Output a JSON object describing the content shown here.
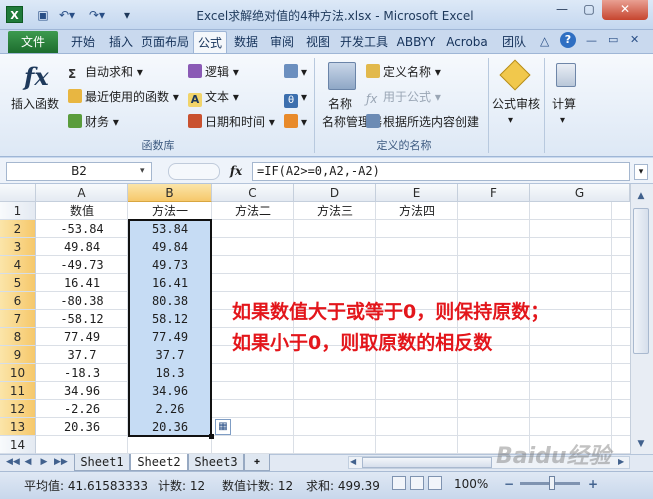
{
  "title": "Excel求解绝对值的4种方法.xlsx - Microsoft Excel",
  "tabs": [
    "文件",
    "开始",
    "插入",
    "页面布局",
    "公式",
    "数据",
    "审阅",
    "视图",
    "开发工具",
    "ABBYY",
    "Acroba",
    "团队"
  ],
  "ribbon": {
    "insert_function": "插入函数",
    "autosum": "自动求和",
    "recent": "最近使用的函数",
    "finance": "财务",
    "logic": "逻辑",
    "text": "文本",
    "datetime": "日期和时间",
    "function_library": "函数库",
    "name_manager": "名称管理器",
    "define_name": "定义名称",
    "use_in_formula": "用于公式",
    "create_from_selection": "根据所选内容创建",
    "defined_names": "定义的名称",
    "formula_audit": "公式审核",
    "calculation": "计算"
  },
  "formula_bar": {
    "name_box": "B2",
    "fx": "fx",
    "formula": "=IF(A2>=0,A2,-A2)"
  },
  "columns": [
    "A",
    "B",
    "C",
    "D",
    "E",
    "F",
    "G"
  ],
  "header_row": [
    "数值",
    "方法一",
    "方法二",
    "方法三",
    "方法四"
  ],
  "col_a": [
    "-53.84",
    "49.84",
    "-49.73",
    "16.41",
    "-80.38",
    "-58.12",
    "77.49",
    "37.7",
    "-18.3",
    "34.96",
    "-2.26",
    "20.36"
  ],
  "col_b": [
    "53.84",
    "49.84",
    "49.73",
    "16.41",
    "80.38",
    "58.12",
    "77.49",
    "37.7",
    "18.3",
    "34.96",
    "2.26",
    "20.36"
  ],
  "rows": [
    "1",
    "2",
    "3",
    "4",
    "5",
    "6",
    "7",
    "8",
    "9",
    "10",
    "11",
    "12",
    "13",
    "14"
  ],
  "annotation": {
    "line1": "如果数值大于或等于0，则保持原数；",
    "line2": "如果小于0，则取原数的相反数"
  },
  "sheets": [
    "Sheet1",
    "Sheet2",
    "Sheet3"
  ],
  "active_sheet": "Sheet2",
  "status": {
    "average": "平均值: 41.61583333",
    "count": "计数: 12",
    "numcount": "数值计数: 12",
    "sum": "求和: 499.39",
    "zoom": "100%"
  },
  "watermark": "Baidu经验"
}
